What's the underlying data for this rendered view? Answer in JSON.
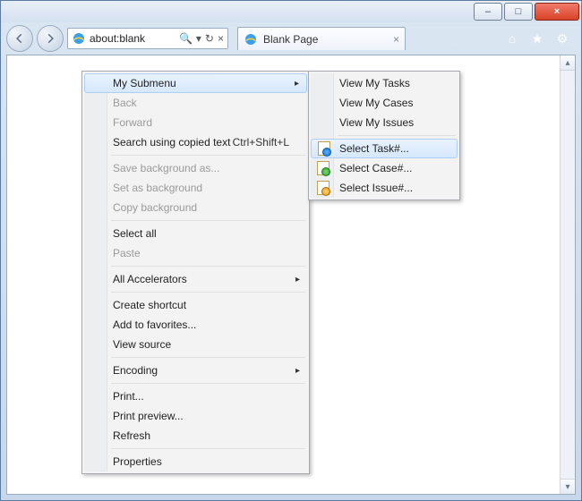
{
  "window": {
    "min_label": "–",
    "max_label": "□",
    "close_label": "×"
  },
  "nav": {
    "address": "about:blank",
    "search_icon": "🔍",
    "dropdown_icon": "▾",
    "refresh_icon": "↻",
    "stop_icon": "×"
  },
  "tab": {
    "title": "Blank Page",
    "close": "×"
  },
  "commands": {
    "home": "⌂",
    "fav": "★",
    "tools": "⚙"
  },
  "scrollbar": {
    "up": "▴",
    "down": "▾"
  },
  "context_menu": {
    "my_submenu": "My Submenu",
    "back": "Back",
    "forward": "Forward",
    "search_copied": "Search using copied text",
    "search_copied_shortcut": "Ctrl+Shift+L",
    "save_bg": "Save background as...",
    "set_bg": "Set as background",
    "copy_bg": "Copy background",
    "select_all": "Select all",
    "paste": "Paste",
    "all_accel": "All Accelerators",
    "create_shortcut": "Create shortcut",
    "add_fav": "Add to favorites...",
    "view_source": "View source",
    "encoding": "Encoding",
    "print": "Print...",
    "print_preview": "Print preview...",
    "refresh": "Refresh",
    "properties": "Properties",
    "arrow": "▸"
  },
  "submenu": {
    "my_tasks": "View My Tasks",
    "my_cases": "View My Cases",
    "my_issues": "View My Issues",
    "select_task": "Select Task#...",
    "select_case": "Select Case#...",
    "select_issue": "Select Issue#..."
  }
}
